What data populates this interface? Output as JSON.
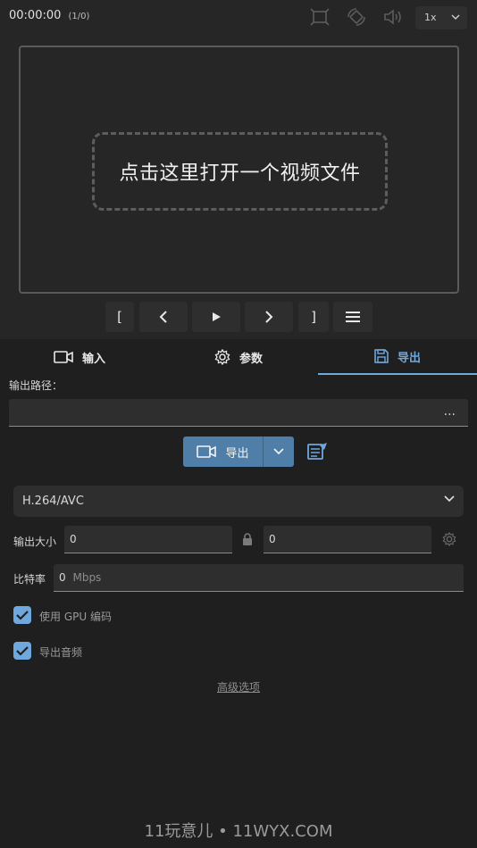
{
  "topbar": {
    "time": "00:00:00",
    "counter": "(1/0)",
    "speed": "1x",
    "icons": [
      "fullscreen-icon",
      "rotate-icon",
      "volume-icon"
    ]
  },
  "player": {
    "drop_text": "点击这里打开一个视频文件"
  },
  "controls": {
    "mark_in": "[",
    "mark_out": "]"
  },
  "tabs": [
    {
      "label": "输入",
      "icon": "video-camera-icon"
    },
    {
      "label": "参数",
      "icon": "gear-icon"
    },
    {
      "label": "导出",
      "icon": "save-icon",
      "active": true
    }
  ],
  "export": {
    "path_label": "输出路径：",
    "path_value": "",
    "browse": "...",
    "export_button": "导出",
    "codec": "H.264/AVC",
    "size_label": "输出大小",
    "width": "0",
    "height": "0",
    "bitrate_label": "比特率",
    "bitrate_value": "0",
    "bitrate_unit": "Mbps",
    "gpu_label": "使用 GPU 编码",
    "gpu_checked": true,
    "audio_label": "导出音频",
    "audio_checked": true,
    "advanced": "高级选项"
  },
  "watermark": "11玩意儿 • 11WYX.COM",
  "colors": {
    "accent": "#6fa8dc",
    "button": "#4f7fa8",
    "panel": "#1f1f1f",
    "background": "#262626"
  }
}
